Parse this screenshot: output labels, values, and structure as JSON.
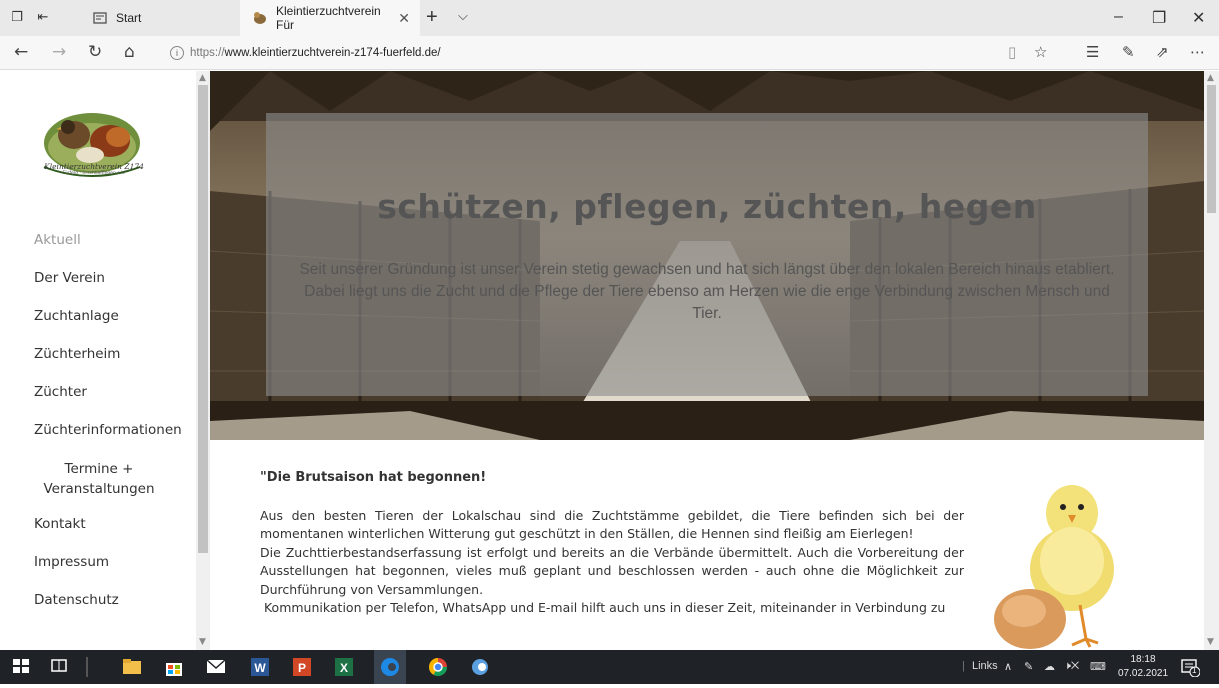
{
  "browser": {
    "tabs": [
      {
        "label": "Start"
      },
      {
        "label": "Kleintierzuchtverein Für"
      }
    ],
    "url_scheme": "https://",
    "url_host": "www.kleintierzuchtverein-z174-fuerfeld.de/"
  },
  "sidebar": {
    "logo_text": "Kleintierzuchtverein Z174",
    "logo_subtext": "Fürfeld · Irrschlieffingen e.V.",
    "items": [
      {
        "label": "Aktuell"
      },
      {
        "label": "Der Verein"
      },
      {
        "label": "Zuchtanlage"
      },
      {
        "label": "Züchterheim"
      },
      {
        "label": "Züchter"
      },
      {
        "label": "Züchterinformationen"
      },
      {
        "label": "Termine +"
      },
      {
        "label": "Veranstaltungen"
      },
      {
        "label": "Kontakt"
      },
      {
        "label": "Impressum"
      },
      {
        "label": "Datenschutz"
      }
    ]
  },
  "hero": {
    "title": "schützen, pflegen, züchten, hegen",
    "text": "Seit unserer Gründung ist unser Verein stetig gewachsen und hat sich längst über den lokalen Bereich hinaus etabliert. Dabei liegt uns die Zucht und die Pflege der Tiere ebenso am Herzen wie die enge Verbindung zwischen Mensch und Tier."
  },
  "article": {
    "heading": "\"Die Brutsaison hat begonnen!",
    "p1": "Aus den besten Tieren der Lokalschau sind die Zuchtstämme gebildet, die Tiere befinden sich bei der momentanen winterlichen Witterung gut geschützt in den Ställen, die Hennen sind fleißig am Eierlegen!",
    "p2": "Die Zuchttierbestandserfassung ist erfolgt und bereits an die Verbände übermittelt. Auch die Vorbereitung der Ausstellungen hat begonnen, vieles muß geplant und beschlossen werden - auch ohne die Möglichkeit zur Durchführung von Versammlungen.",
    "p3": " Kommunikation per Telefon, WhatsApp und E-mail hilft auch uns in dieser Zeit, miteinander in Verbindung zu"
  },
  "taskbar": {
    "links_label": "Links",
    "time": "18:18",
    "date": "07.02.2021",
    "notification_count": "1"
  }
}
